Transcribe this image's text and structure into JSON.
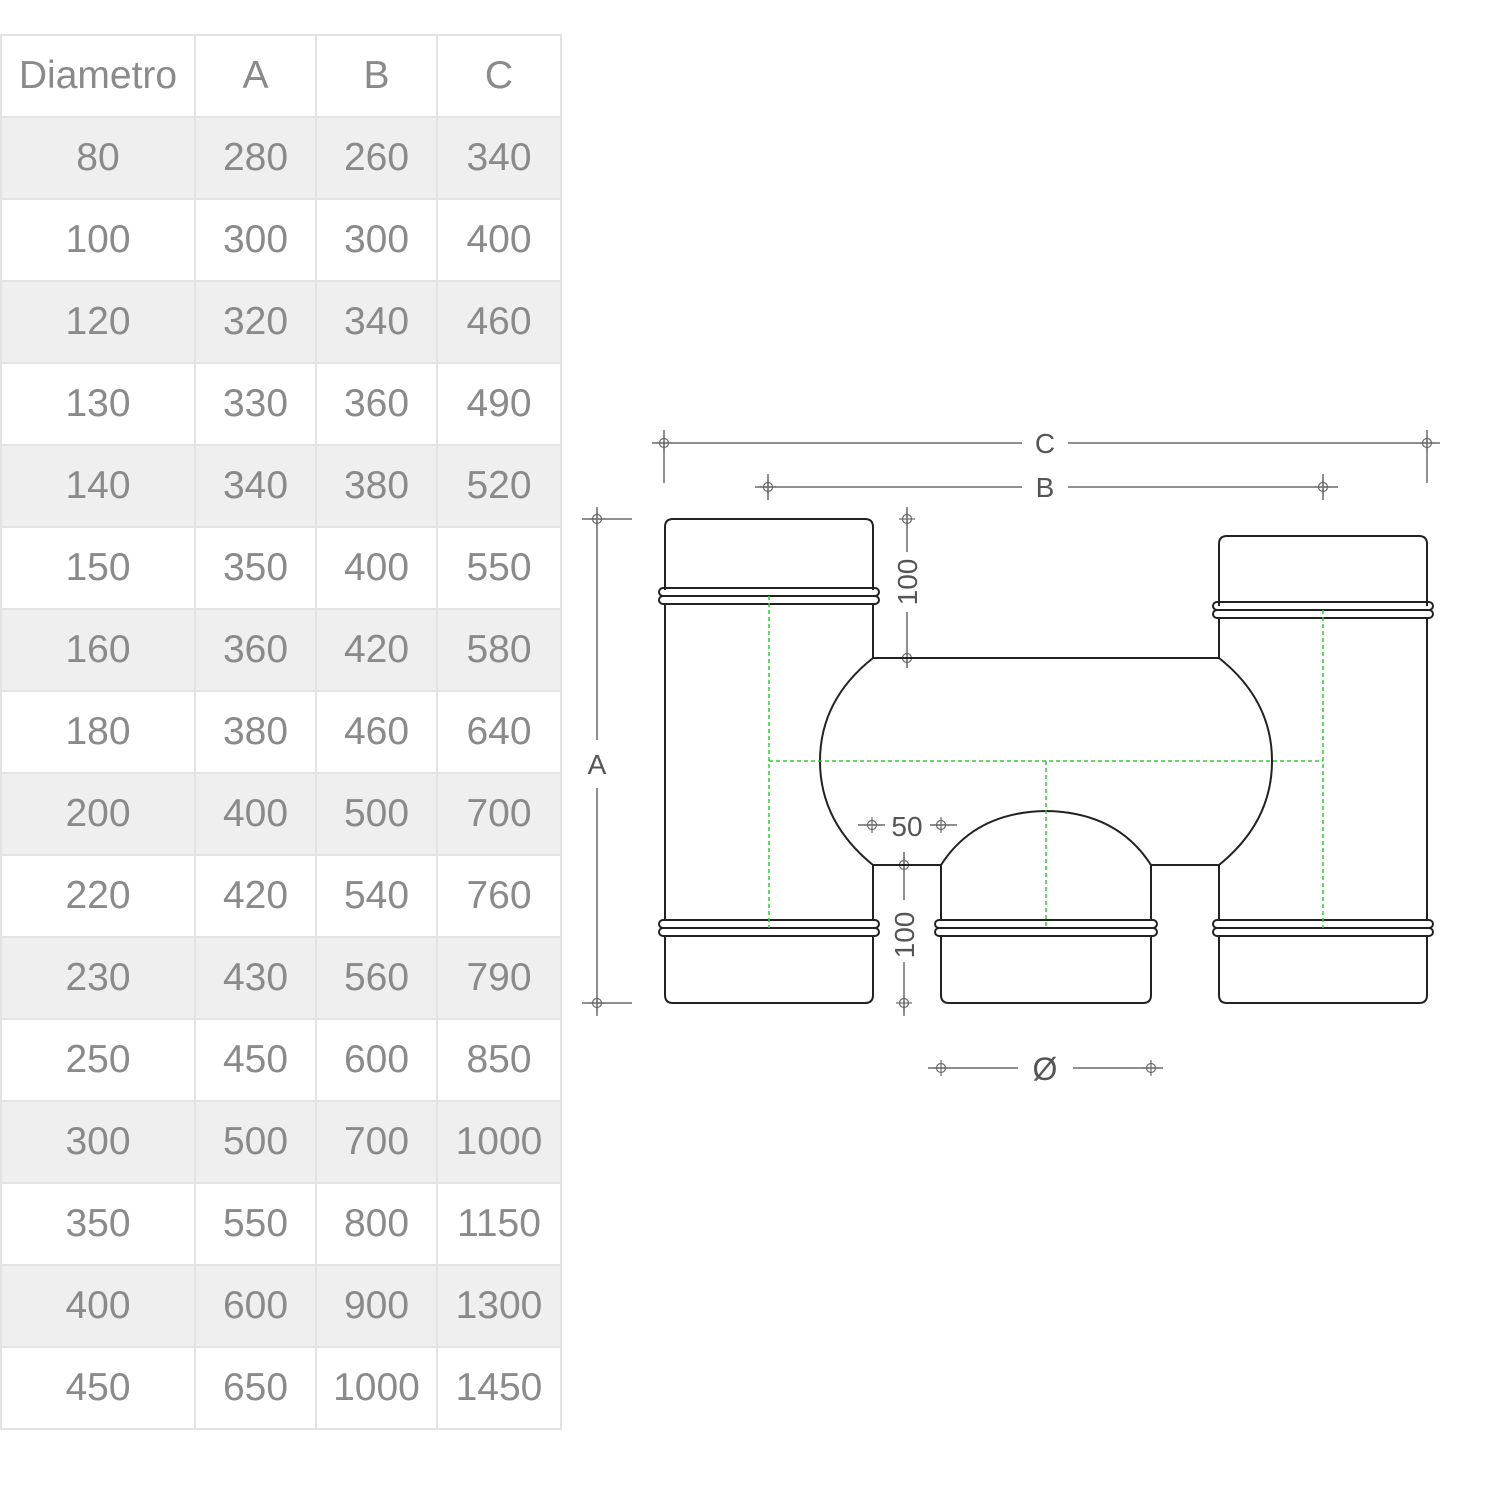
{
  "table": {
    "headers": [
      "Diametro",
      "A",
      "B",
      "C"
    ],
    "rows": [
      [
        "80",
        "280",
        "260",
        "340"
      ],
      [
        "100",
        "300",
        "300",
        "400"
      ],
      [
        "120",
        "320",
        "340",
        "460"
      ],
      [
        "130",
        "330",
        "360",
        "490"
      ],
      [
        "140",
        "340",
        "380",
        "520"
      ],
      [
        "150",
        "350",
        "400",
        "550"
      ],
      [
        "160",
        "360",
        "420",
        "580"
      ],
      [
        "180",
        "380",
        "460",
        "640"
      ],
      [
        "200",
        "400",
        "500",
        "700"
      ],
      [
        "220",
        "420",
        "540",
        "760"
      ],
      [
        "230",
        "430",
        "560",
        "790"
      ],
      [
        "250",
        "450",
        "600",
        "850"
      ],
      [
        "300",
        "500",
        "700",
        "1000"
      ],
      [
        "350",
        "550",
        "800",
        "1150"
      ],
      [
        "400",
        "600",
        "900",
        "1300"
      ],
      [
        "450",
        "650",
        "1000",
        "1450"
      ]
    ]
  },
  "drawing": {
    "label_c": "C",
    "label_b": "B",
    "label_a": "A",
    "label_top_gap": "100",
    "label_bottom_gap": "100",
    "label_offset": "50",
    "label_diameter": "Ø"
  },
  "colors": {
    "outline": "#222222",
    "dimension": "#6a6a6a",
    "centerline": "#33cc33",
    "table_text": "#8a8a8a",
    "table_border": "#e3e3e3",
    "row_shade": "#efefef"
  }
}
